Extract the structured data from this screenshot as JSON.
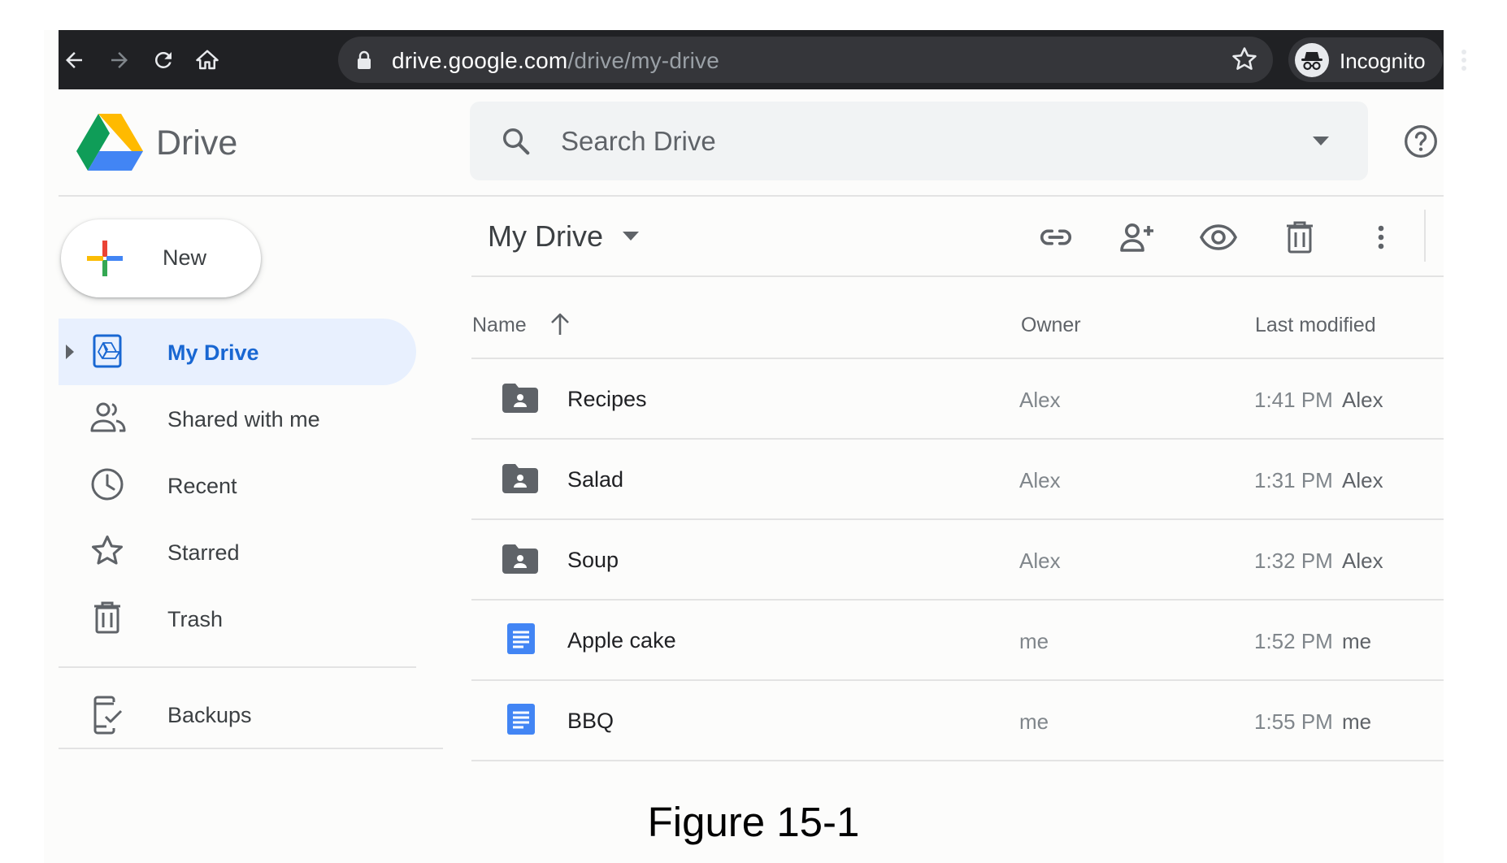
{
  "browser": {
    "url_host": "drive.google.com",
    "url_path": "/drive/my-drive",
    "profile_label": "Incognito",
    "icons": [
      "back-arrow-icon",
      "forward-arrow-icon",
      "reload-icon",
      "home-icon",
      "lock-icon",
      "bookmark-star-icon",
      "incognito-icon",
      "more-vertical-icon"
    ]
  },
  "header": {
    "app_name": "Drive",
    "search_placeholder": "Search Drive"
  },
  "sidebar": {
    "new_label": "New",
    "items": [
      {
        "label": "My Drive",
        "icon": "my-drive-icon",
        "active": true
      },
      {
        "label": "Shared with me",
        "icon": "people-icon"
      },
      {
        "label": "Recent",
        "icon": "clock-icon"
      },
      {
        "label": "Starred",
        "icon": "star-icon"
      },
      {
        "label": "Trash",
        "icon": "trash-icon"
      },
      {
        "label": "Backups",
        "icon": "backup-icon"
      }
    ]
  },
  "toolbar": {
    "location": "My Drive",
    "actions": [
      "link-icon",
      "share-person-add-icon",
      "preview-eye-icon",
      "delete-trash-icon",
      "more-vertical-icon"
    ]
  },
  "file_list": {
    "columns": {
      "name": "Name",
      "owner": "Owner",
      "modified": "Last modified"
    },
    "sort": "name-ascending",
    "rows": [
      {
        "name": "Recipes",
        "type": "shared-folder",
        "owner": "Alex",
        "time": "1:41 PM",
        "modified_by": "Alex"
      },
      {
        "name": "Salad",
        "type": "shared-folder",
        "owner": "Alex",
        "time": "1:31 PM",
        "modified_by": "Alex"
      },
      {
        "name": "Soup",
        "type": "shared-folder",
        "owner": "Alex",
        "time": "1:32 PM",
        "modified_by": "Alex"
      },
      {
        "name": "Apple cake",
        "type": "google-doc",
        "owner": "me",
        "time": "1:52 PM",
        "modified_by": "me"
      },
      {
        "name": "BBQ",
        "type": "google-doc",
        "owner": "me",
        "time": "1:55 PM",
        "modified_by": "me"
      }
    ]
  },
  "caption": "Figure 15-1",
  "colors": {
    "chrome": "#202124",
    "omnibox": "#35363a",
    "active_nav_bg": "#e8f0fe",
    "active_nav_text": "#1967d2",
    "doc_blue": "#4285f4",
    "folder": "#5f6368"
  }
}
